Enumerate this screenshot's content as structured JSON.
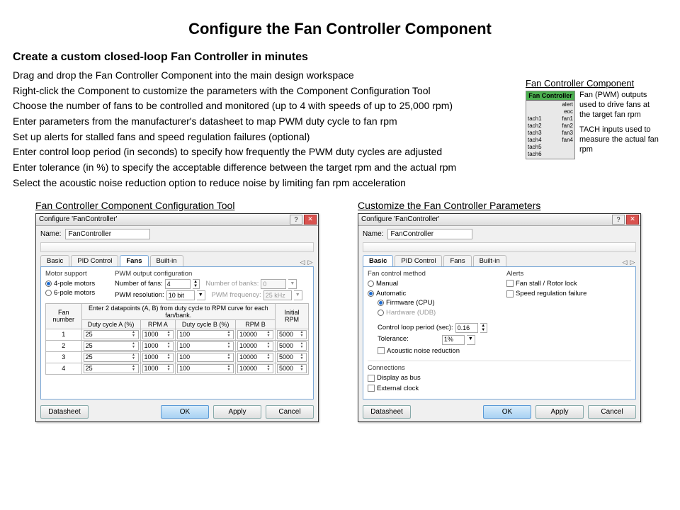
{
  "title": "Configure the Fan Controller Component",
  "intro": {
    "heading": "Create a custom closed-loop Fan Controller in minutes",
    "lines": [
      "Drag and drop the Fan Controller Component into the main design workspace",
      "Right-click the Component to customize the parameters with the Component Configuration Tool",
      "Choose the number of fans to be controlled and monitored (up to 4 with speeds of up to 25,000 rpm)",
      "Enter parameters from the manufacturer's datasheet to map PWM duty cycle to fan rpm",
      "Set up alerts for stalled fans and speed regulation failures (optional)",
      "Enter control loop period (in seconds) to specify how frequently the PWM duty cycles are adjusted",
      "Enter tolerance (in %) to specify the acceptable difference between the target rpm and the actual rpm",
      "Select the acoustic noise reduction option to reduce noise by limiting fan rpm acceleration"
    ]
  },
  "side": {
    "heading": "Fan Controller Component",
    "chip_title": "Fan Controller",
    "left_pins_top": [
      "",
      ""
    ],
    "right_pins_top": [
      "alert",
      "eoc"
    ],
    "left_pins": [
      "tach1",
      "tach2",
      "tach3",
      "tach4",
      "tach5",
      "tach6"
    ],
    "right_pins": [
      "fan1",
      "fan2",
      "fan3",
      "fan4"
    ],
    "desc1": "Fan (PWM) outputs used to drive fans at the target fan rpm",
    "desc2": "TACH inputs used to measure the actual fan rpm"
  },
  "dlg_fans": {
    "caption": "Fan Controller Component Configuration Tool",
    "title": "Configure 'FanController'",
    "name_label": "Name:",
    "name_value": "FanController",
    "tabs": [
      "Basic",
      "PID Control",
      "Fans",
      "Built-in"
    ],
    "active_tab": 2,
    "motor_support_label": "Motor support",
    "motor4": "4-pole motors",
    "motor6": "6-pole motors",
    "pwm_cfg_label": "PWM output configuration",
    "num_fans_label": "Number of fans:",
    "num_fans_value": "4",
    "num_banks_label": "Number of banks:",
    "num_banks_value": "0",
    "pwm_res_label": "PWM resolution:",
    "pwm_res_value": "10 bit",
    "pwm_freq_label": "PWM frequency:",
    "pwm_freq_value": "25 kHz",
    "table_header_note": "Enter 2 datapoints (A, B) from duty cycle to RPM curve for each fan/bank.",
    "cols": [
      "Fan number",
      "Duty cycle A (%)",
      "RPM A",
      "Duty cycle B (%)",
      "RPM B",
      "Initial RPM"
    ],
    "rows": [
      {
        "n": "1",
        "dA": "25",
        "rA": "1000",
        "dB": "100",
        "rB": "10000",
        "init": "5000"
      },
      {
        "n": "2",
        "dA": "25",
        "rA": "1000",
        "dB": "100",
        "rB": "10000",
        "init": "5000"
      },
      {
        "n": "3",
        "dA": "25",
        "rA": "1000",
        "dB": "100",
        "rB": "10000",
        "init": "5000"
      },
      {
        "n": "4",
        "dA": "25",
        "rA": "1000",
        "dB": "100",
        "rB": "10000",
        "init": "5000"
      }
    ],
    "btn_datasheet": "Datasheet",
    "btn_ok": "OK",
    "btn_apply": "Apply",
    "btn_cancel": "Cancel"
  },
  "dlg_basic": {
    "caption": "Customize the Fan Controller Parameters",
    "title": "Configure 'FanController'",
    "name_label": "Name:",
    "name_value": "FanController",
    "tabs": [
      "Basic",
      "PID Control",
      "Fans",
      "Built-in"
    ],
    "active_tab": 0,
    "fcm_label": "Fan control method",
    "manual": "Manual",
    "automatic": "Automatic",
    "firmware": "Firmware (CPU)",
    "hardware": "Hardware (UDB)",
    "clp_label": "Control loop period (sec):",
    "clp_value": "0.16",
    "tol_label": "Tolerance:",
    "tol_value": "1%",
    "anr": "Acoustic noise reduction",
    "alerts_label": "Alerts",
    "alert1": "Fan stall / Rotor lock",
    "alert2": "Speed regulation failure",
    "conn_label": "Connections",
    "conn1": "Display as bus",
    "conn2": "External clock",
    "btn_datasheet": "Datasheet",
    "btn_ok": "OK",
    "btn_apply": "Apply",
    "btn_cancel": "Cancel"
  }
}
